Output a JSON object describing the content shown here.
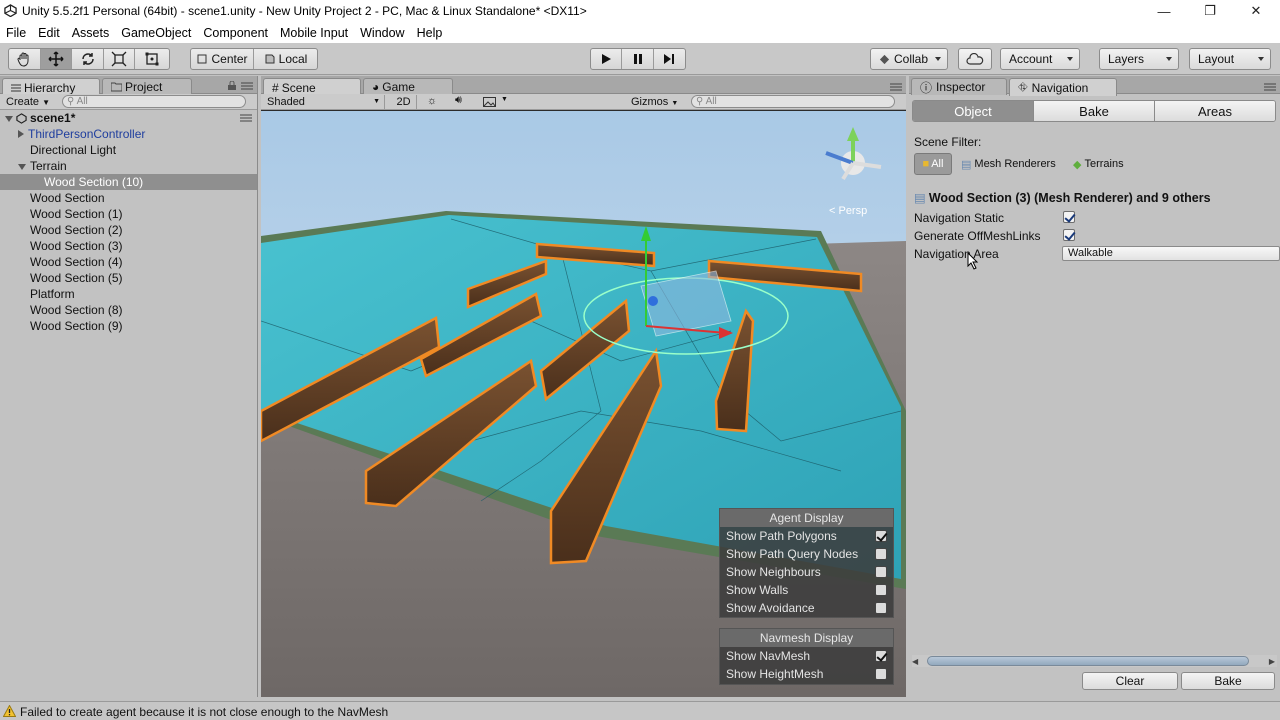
{
  "window": {
    "title": "Unity 5.5.2f1 Personal (64bit) - scene1.unity - New Unity Project 2 - PC, Mac & Linux Standalone* <DX11>",
    "minimize": "—",
    "restore": "❐",
    "close": "✕"
  },
  "menu": [
    "File",
    "Edit",
    "Assets",
    "GameObject",
    "Component",
    "Mobile Input",
    "Window",
    "Help"
  ],
  "toolbar": {
    "pivot": "Center",
    "space": "Local",
    "collab": "Collab",
    "account": "Account",
    "layers": "Layers",
    "layout": "Layout"
  },
  "hierarchy": {
    "tab": "Hierarchy",
    "tab2": "Project",
    "create": "Create",
    "search_placeholder": "All",
    "scene": "scene1*",
    "items": [
      {
        "label": "ThirdPersonController",
        "indent": 1,
        "expandable": true,
        "prefab": true
      },
      {
        "label": "Directional Light",
        "indent": 1
      },
      {
        "label": "Terrain",
        "indent": 1,
        "expanded": true
      },
      {
        "label": "Wood Section (10)",
        "indent": 2,
        "selected": true
      },
      {
        "label": "Wood Section",
        "indent": 1
      },
      {
        "label": "Wood Section (1)",
        "indent": 1
      },
      {
        "label": "Wood Section (2)",
        "indent": 1
      },
      {
        "label": "Wood Section (3)",
        "indent": 1
      },
      {
        "label": "Wood Section (4)",
        "indent": 1
      },
      {
        "label": "Wood Section (5)",
        "indent": 1
      },
      {
        "label": "Platform",
        "indent": 1
      },
      {
        "label": "Wood Section (8)",
        "indent": 1
      },
      {
        "label": "Wood Section (9)",
        "indent": 1
      }
    ]
  },
  "scene": {
    "tab": "Scene",
    "tab2": "Game",
    "shading": "Shaded",
    "mode2d": "2D",
    "gizmos": "Gizmos",
    "search_placeholder": "All",
    "persp": "< Persp",
    "agent_display": {
      "title": "Agent Display",
      "rows": [
        {
          "label": "Show Path Polygons",
          "checked": true
        },
        {
          "label": "Show Path Query Nodes",
          "checked": false
        },
        {
          "label": "Show Neighbours",
          "checked": false
        },
        {
          "label": "Show Walls",
          "checked": false
        },
        {
          "label": "Show Avoidance",
          "checked": false
        }
      ]
    },
    "navmesh_display": {
      "title": "Navmesh Display",
      "rows": [
        {
          "label": "Show NavMesh",
          "checked": true
        },
        {
          "label": "Show HeightMesh",
          "checked": false
        }
      ]
    }
  },
  "inspector": {
    "tab": "Inspector",
    "tab2": "Navigation",
    "modes": [
      "Object",
      "Bake",
      "Areas"
    ],
    "scene_filter_label": "Scene Filter:",
    "filters": [
      "All",
      "Mesh Renderers",
      "Terrains"
    ],
    "object_title": "Wood Section (3) (Mesh Renderer) and 9 others",
    "nav_static_label": "Navigation Static",
    "nav_static": true,
    "offmesh_label": "Generate OffMeshLinks",
    "offmesh": true,
    "area_label": "Navigation Area",
    "area_value": "Walkable",
    "clear_button": "Clear",
    "bake_button": "Bake"
  },
  "status": {
    "message": "Failed to create agent because it is not close enough to the NavMesh"
  },
  "colors": {
    "selection": "#8f8f8f",
    "prefab_text": "#1f3e9e",
    "water": "#3fb8c6",
    "outline": "#f08a24"
  }
}
